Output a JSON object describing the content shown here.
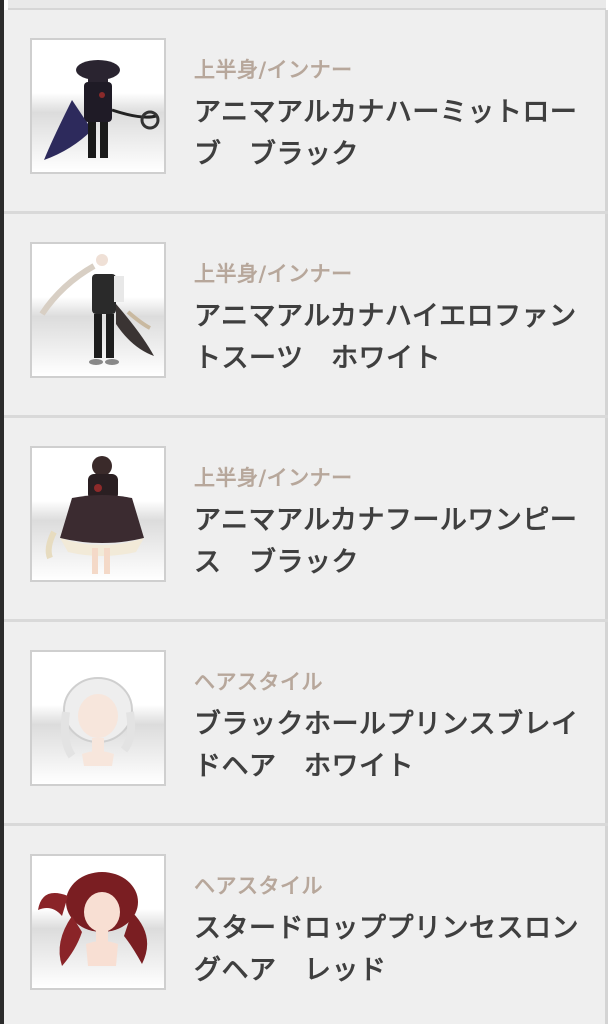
{
  "items": [
    {
      "category": "上半身/インナー",
      "title": "アニマアルカナハーミットローブ　ブラック",
      "thumb_icon": "dark-robe-outfit-icon"
    },
    {
      "category": "上半身/インナー",
      "title": "アニマアルカナハイエロファントスーツ　ホワイト",
      "thumb_icon": "suit-outfit-icon"
    },
    {
      "category": "上半身/インナー",
      "title": "アニマアルカナフールワンピース　ブラック",
      "thumb_icon": "dress-outfit-icon"
    },
    {
      "category": "ヘアスタイル",
      "title": "ブラックホールプリンスブレイドヘア　ホワイト",
      "thumb_icon": "white-braid-hair-icon"
    },
    {
      "category": "ヘアスタイル",
      "title": "スタードロッププリンセスロングヘア　レッド",
      "thumb_icon": "red-long-hair-icon"
    }
  ]
}
